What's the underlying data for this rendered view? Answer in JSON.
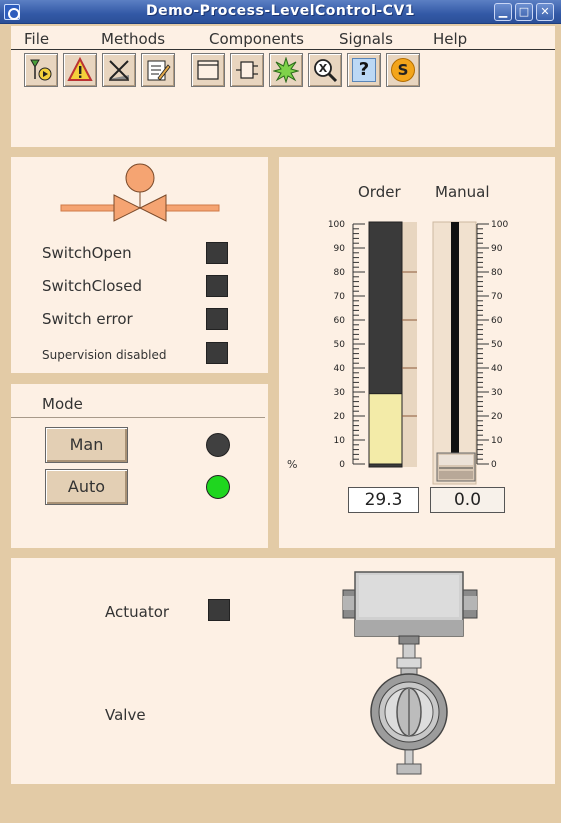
{
  "window": {
    "title": "Demo-Process-LevelControl-CV1",
    "buttons": [
      "minimize-icon",
      "maximize-icon",
      "close-icon"
    ]
  },
  "menu": {
    "items": [
      "File",
      "Methods",
      "Components",
      "Signals",
      "Help"
    ]
  },
  "toolbar": {
    "icons": [
      "trend-icon",
      "alarm-warning-icon",
      "block-icon",
      "notes-icon",
      "object-graph-icon",
      "object-icon",
      "crossreference-icon",
      "search-object-icon",
      "help-icon",
      "simulate-icon"
    ],
    "help_glyph": "?",
    "simulate_glyph": "S"
  },
  "valve_status": {
    "switch_open_label": "SwitchOpen",
    "switch_closed_label": "SwitchClosed",
    "switch_error_label": "Switch error",
    "supervision_label": "Supervision disabled"
  },
  "mode": {
    "title": "Mode",
    "man_label": "Man",
    "auto_label": "Auto",
    "man_indicator_color": "#404040",
    "auto_indicator_color": "#1fd61f"
  },
  "bars": {
    "order_label": "Order",
    "manual_label": "Manual",
    "unit_label": "%",
    "ticks": [
      "100",
      "90",
      "80",
      "70",
      "60",
      "50",
      "40",
      "30",
      "20",
      "10",
      "0"
    ],
    "order_value": 29.3,
    "order_text": "29.3",
    "manual_value": 0.0,
    "manual_text": "0.0",
    "order_fill_color": "#f3eba8"
  },
  "bottom": {
    "actuator_label": "Actuator",
    "valve_label": "Valve"
  },
  "colors": {
    "background": "#e3cba6",
    "panel": "#fdf0e4",
    "indicator_off": "#3a3a3a",
    "valve_symbol": "#f5a472",
    "title_bar": "#3a62ad"
  }
}
